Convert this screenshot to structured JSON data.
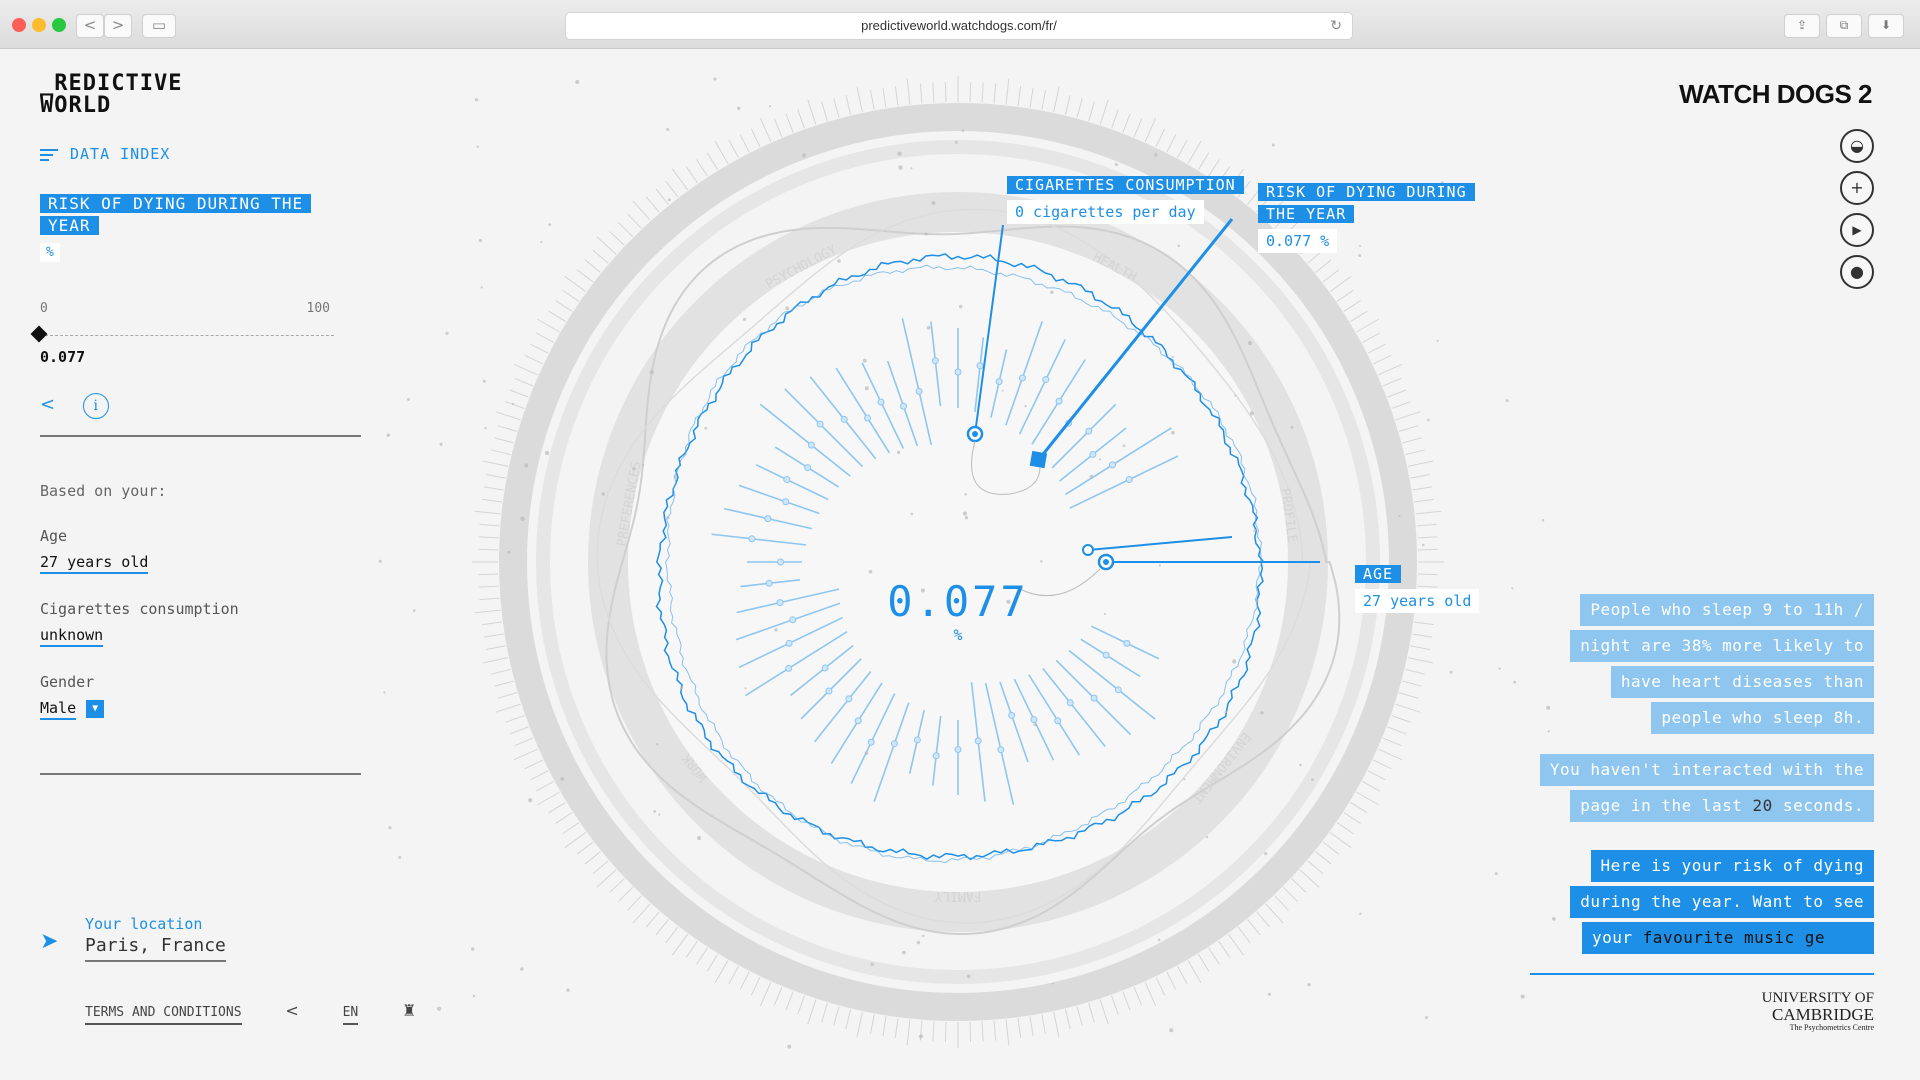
{
  "browser": {
    "url": "predictiveworld.watchdogs.com/fr/",
    "back": "<",
    "forward": ">",
    "reload": "↻"
  },
  "header": {
    "logo_line1": "_REDICTIVE",
    "logo_line2": "WORLD",
    "brand": "WATCH DOGS 2",
    "data_index": "DATA INDEX"
  },
  "metric": {
    "title": "RISK OF DYING DURING THE YEAR",
    "unit": "%",
    "scale_min": "0",
    "scale_max": "100",
    "value": "0.077"
  },
  "based_on": {
    "heading": "Based on your:",
    "age_label": "Age",
    "age_value": "27 years old",
    "cig_label": "Cigarettes consumption",
    "cig_value": "unknown",
    "gender_label": "Gender",
    "gender_value": "Male"
  },
  "location": {
    "label": "Your location",
    "value": "Paris, France"
  },
  "footer": {
    "terms": "TERMS AND CONDITIONS",
    "lang": "EN"
  },
  "viz": {
    "center_value": "0.077",
    "center_unit": "%",
    "callout_cig_title": "CIGARETTES CONSUMPTION",
    "callout_cig_value": "0 cigarettes per day",
    "callout_risk_title": "RISK OF DYING DURING THE YEAR",
    "callout_risk_value": "0.077 %",
    "callout_age_title": "AGE",
    "callout_age_value": "27 years old",
    "sector_labels": [
      "PSYCHOLOGY",
      "HEALTH",
      "PROFILE",
      "ENVIRONMENT",
      "FAMILY",
      "WORK",
      "PREFERENCES"
    ]
  },
  "messages": {
    "m1": [
      "People who sleep 9 to 11h /",
      "night are 38% more likely to",
      "have heart diseases than",
      "people who sleep 8h."
    ],
    "m2_l1": "You haven't interacted with the",
    "m2_l2a": "page in the last ",
    "m2_l2b": "20",
    "m2_l2c": " seconds.",
    "m3_l1": "Here is your risk of dying",
    "m3_l2": "during the year. Want to see",
    "m3_l3a": "your ",
    "m3_l3b": "favourite music ge"
  },
  "partner": {
    "line1": "UNIVERSITY OF",
    "line2": "CAMBRIDGE",
    "line3": "The Psychometrics Centre"
  },
  "colors": {
    "accent": "#1d8fe6",
    "accent_light": "#8fc6f0",
    "background": "#f4f4f4"
  },
  "icons": [
    "gamepad-icon",
    "plus-icon",
    "play-icon",
    "user-icon",
    "share-icon",
    "info-icon",
    "location-arrow-icon",
    "castle-icon"
  ]
}
